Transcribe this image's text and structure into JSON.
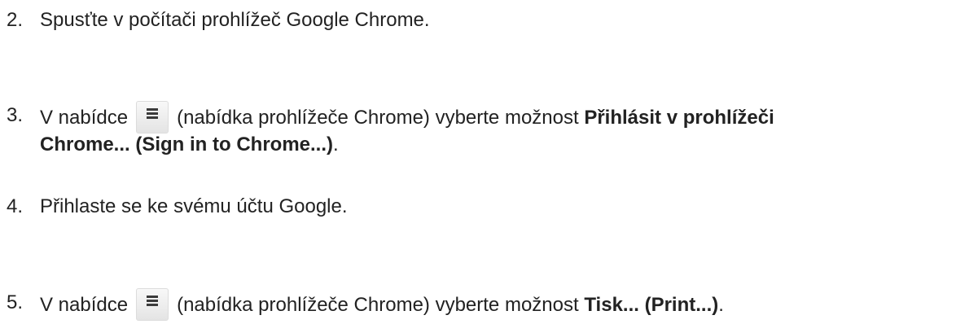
{
  "steps": [
    {
      "number": "2.",
      "text": "Spusťte v počítači prohlížeč Google Chrome."
    },
    {
      "number": "3.",
      "before": "V nabídce",
      "icon": "chrome-menu-icon",
      "after": "(nabídka prohlížeče Chrome) vyberte možnost",
      "bold_line1": "Přihlásit v prohlížeči",
      "bold_line2": "Chrome... (Sign in to Chrome...)",
      "end": "."
    },
    {
      "number": "4.",
      "text": "Přihlaste se ke svému účtu Google."
    },
    {
      "number": "5.",
      "before": "V nabídce",
      "icon": "chrome-menu-icon",
      "after": "(nabídka prohlížeče Chrome) vyberte možnost",
      "bold": "Tisk... (Print...)",
      "end": "."
    }
  ]
}
